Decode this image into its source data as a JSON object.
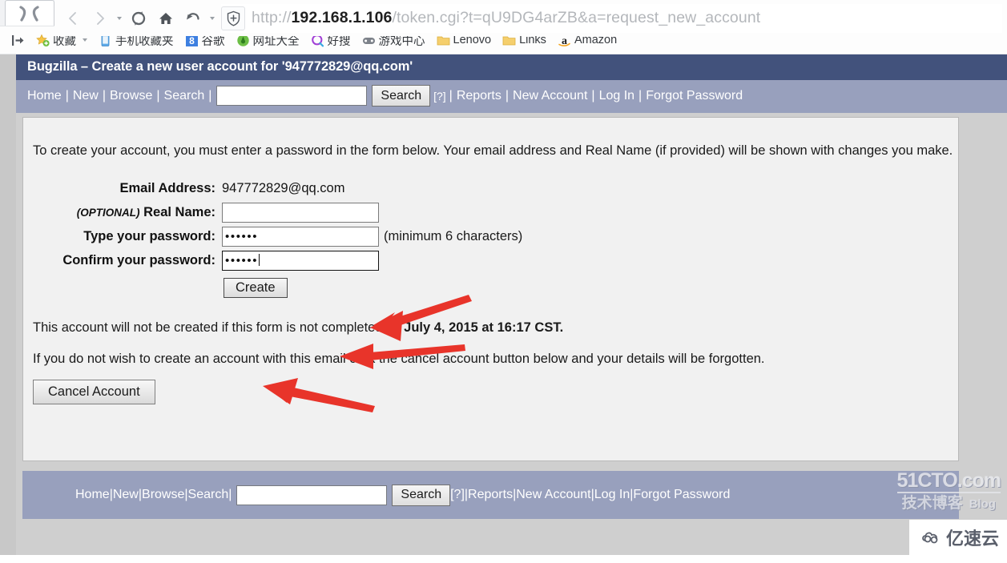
{
  "browser": {
    "tab_logo_name": "browser-tab-logo",
    "toolbar_icons": [
      "back-icon",
      "forward-icon",
      "forward-dropdown-caret",
      "reload-icon",
      "home-icon",
      "history-back-icon",
      "history-dropdown-caret",
      "shield-security-icon"
    ],
    "url": {
      "scheme": "http://",
      "host": "192.168.1.106",
      "path": "/token.cgi?t=qU9DG4arZB&a=request_new_account",
      "full": "http://192.168.1.106/token.cgi?t=qU9DG4arZB&a=request_new_account"
    },
    "bookmarks": [
      {
        "label": "",
        "icon": "import-bookmarks-icon"
      },
      {
        "label": "收藏",
        "icon": "favorites-star-icon",
        "has_caret": true
      },
      {
        "label": "手机收藏夹",
        "icon": "phone-icon"
      },
      {
        "label": "谷歌",
        "icon": "google-icon"
      },
      {
        "label": "网址大全",
        "icon": "hao123-icon"
      },
      {
        "label": "好搜",
        "icon": "haosou-search-icon"
      },
      {
        "label": "游戏中心",
        "icon": "gamepad-icon"
      },
      {
        "label": "Lenovo",
        "icon": "folder-icon"
      },
      {
        "label": "Links",
        "icon": "folder-icon"
      },
      {
        "label": "Amazon",
        "icon": "amazon-icon"
      }
    ]
  },
  "bugzilla": {
    "banner_title": "Bugzilla – Create a new user account for '947772829@qq.com'",
    "nav": {
      "links_before": [
        "Home",
        "New",
        "Browse",
        "Search"
      ],
      "search_placeholder": "",
      "search_value": "",
      "search_button": "Search",
      "help_marker": "[?]",
      "links_after": [
        "Reports",
        "New Account",
        "Log In",
        "Forgot Password"
      ],
      "separator": "|"
    },
    "intro": "To create your account, you must enter a password in the form below. Your email address and Real Name (if provided) will be shown with changes you make.",
    "form": {
      "email_label": "Email Address:",
      "email_value": "947772829@qq.com",
      "realname_optional": "(OPTIONAL)",
      "realname_label": "Real Name:",
      "realname_value": "",
      "password_label": "Type your password:",
      "password_value": "••••••",
      "password_hint": "(minimum 6 characters)",
      "confirm_label": "Confirm your password:",
      "confirm_value": "••••••",
      "create_button": "Create"
    },
    "expiry_note_prefix": "This account will not be created if this form is not completed by ",
    "expiry_datetime": "July 4, 2015 at 16:17",
    "expiry_note_suffix": " CST.",
    "cancel_note": "If you do not wish to create an account with this email click the cancel account button below and your details will be forgotten.",
    "cancel_button": "Cancel Account",
    "colors": {
      "banner": "#42527c",
      "navbar": "#98a0bd",
      "content_bg": "#f1f1f1",
      "page_bg": "#cfcfcf",
      "arrow": "#e8342a"
    }
  },
  "annotations": {
    "arrow_count": 3,
    "arrow_targets": [
      "password-field",
      "confirm-password-field",
      "create-button"
    ],
    "arrow_color": "#e8342a"
  },
  "watermarks": {
    "site_line1": "51CTO.com",
    "site_line2": "技术博客",
    "site_blog": "Blog",
    "yisu": "亿速云"
  }
}
